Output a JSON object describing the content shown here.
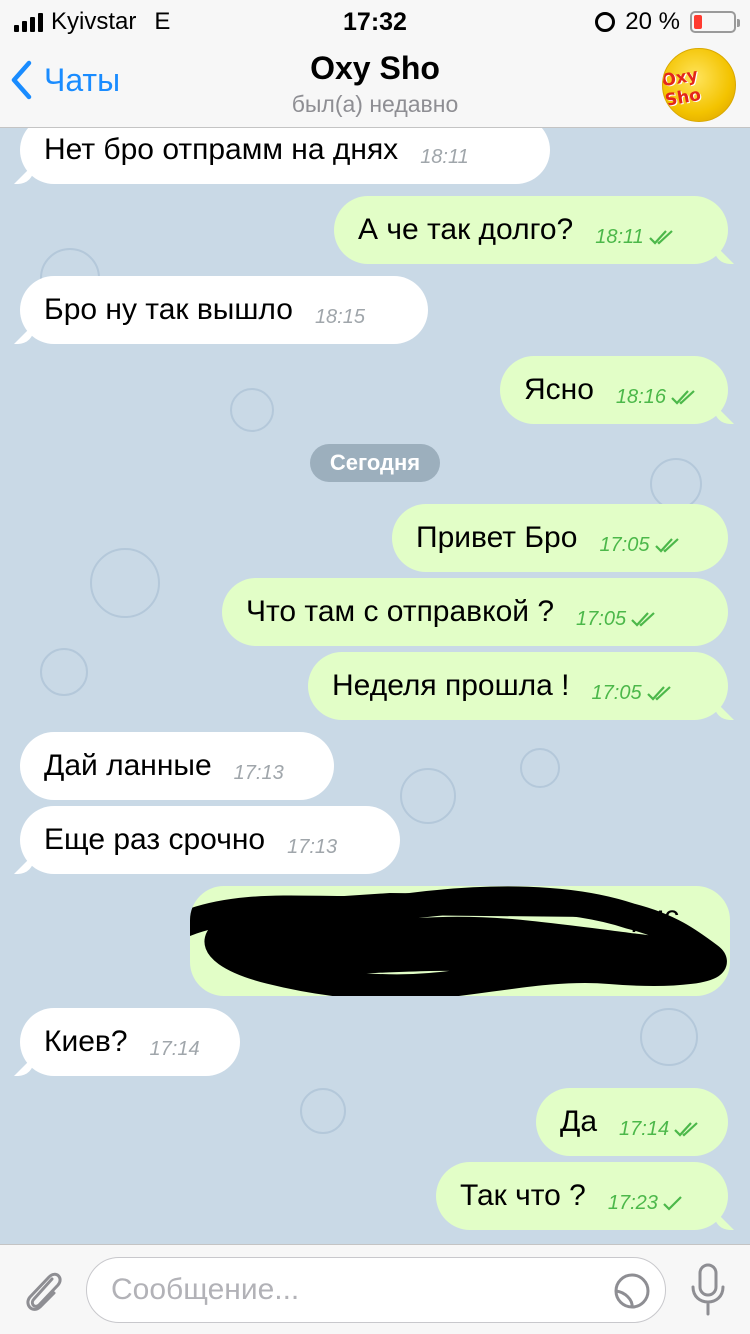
{
  "status_bar": {
    "carrier": "Kyivstar",
    "network": "E",
    "time": "17:32",
    "battery_text": "20 %",
    "battery_level": 0.2,
    "icons": [
      "signal-icon",
      "alarm-icon",
      "battery-icon"
    ]
  },
  "nav": {
    "back_label": "Чаты",
    "title": "Oxy Sho",
    "subtitle": "был(а) недавно",
    "avatar_text": "Oxy Sho"
  },
  "chat": {
    "date_separator": "Сегодня",
    "messages": [
      {
        "dir": "in",
        "text": "Нет бро отпрамм на днях",
        "time": "18:11"
      },
      {
        "dir": "out",
        "text": "А че так долго?",
        "time": "18:11",
        "status": "read"
      },
      {
        "dir": "in",
        "text": "Бро ну так вышло",
        "time": "18:15"
      },
      {
        "dir": "out",
        "text": "Ясно",
        "time": "18:16",
        "status": "read"
      },
      {
        "dir": "out",
        "text": "Привет Бро",
        "time": "17:05",
        "status": "read"
      },
      {
        "dir": "out",
        "text": "Что там с отправкой ?",
        "time": "17:05",
        "status": "read"
      },
      {
        "dir": "out",
        "text": "Неделя прошла !",
        "time": "17:05",
        "status": "read"
      },
      {
        "dir": "in",
        "text": "Дай ланные",
        "time": "17:13"
      },
      {
        "dir": "in",
        "text": "Еще раз срочно",
        "time": "17:13"
      },
      {
        "dir": "out",
        "text": "ерис",
        "time": "",
        "status": "read",
        "redacted": true
      },
      {
        "dir": "in",
        "text": "Киев?",
        "time": "17:14"
      },
      {
        "dir": "out",
        "text": "Да",
        "time": "17:14",
        "status": "read"
      },
      {
        "dir": "out",
        "text": "Так что ?",
        "time": "17:23",
        "status": "delivered"
      }
    ]
  },
  "input": {
    "placeholder": "Сообщение..."
  },
  "colors": {
    "accent": "#1a8cff",
    "incoming_bubble": "#ffffff",
    "outgoing_bubble": "#e2fec7",
    "outgoing_time": "#4cb84a",
    "wallpaper": "#c9d9e6"
  }
}
